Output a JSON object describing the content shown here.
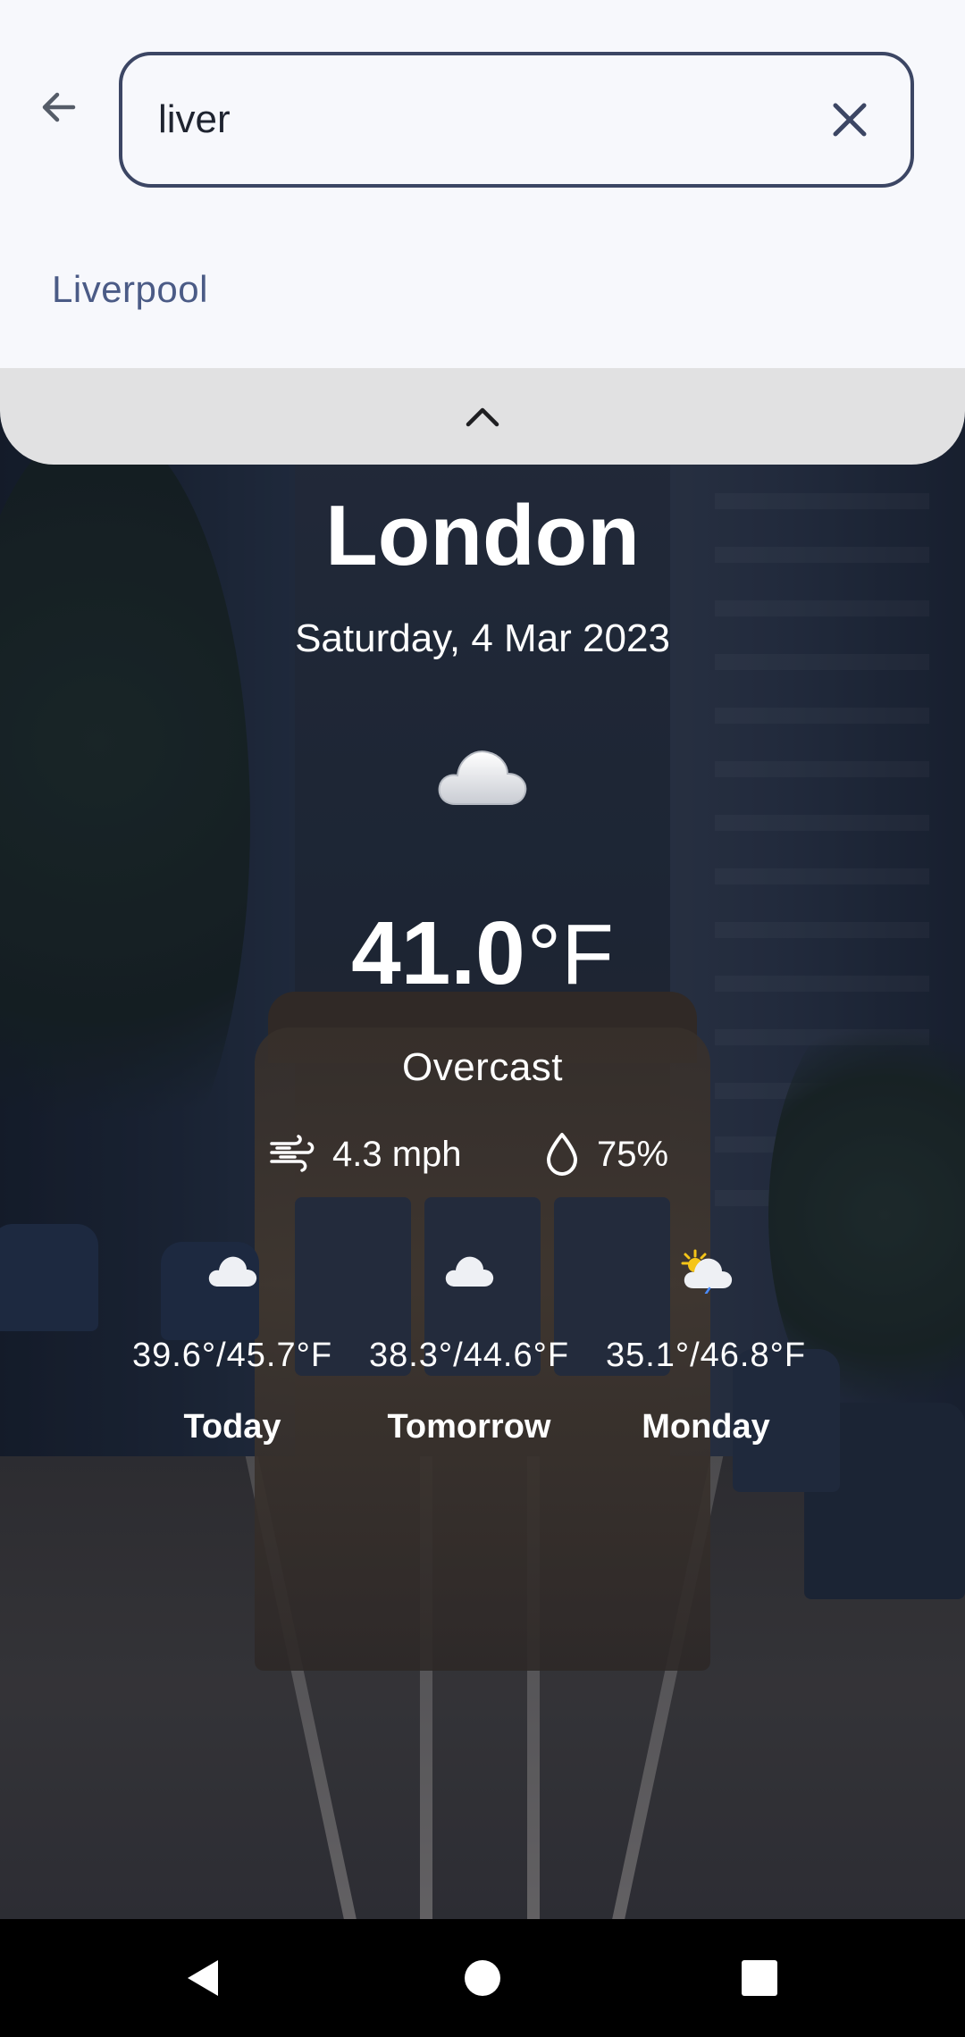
{
  "search": {
    "query": "liver",
    "suggestions": [
      "Liverpool"
    ]
  },
  "icons": {
    "back": "arrow-left-icon",
    "clear": "close-icon",
    "sheet_toggle": "chevron-up-icon",
    "condition": "cloud-icon",
    "wind": "wind-icon",
    "humidity": "droplet-icon"
  },
  "weather": {
    "city": "London",
    "date": "Saturday, 4 Mar 2023",
    "temperature": "41.0",
    "unit": "°F",
    "condition": "Overcast",
    "wind": "4.3 mph",
    "humidity": "75%"
  },
  "forecast": [
    {
      "day": "Today",
      "range": "39.6°/45.7°F",
      "icon": "cloud-icon"
    },
    {
      "day": "Tomorrow",
      "range": "38.3°/44.6°F",
      "icon": "cloud-icon"
    },
    {
      "day": "Monday",
      "range": "35.1°/46.8°F",
      "icon": "partly-sunny-icon"
    }
  ],
  "colors": {
    "search_border": "#3c4664",
    "suggestion_text": "#4b5b86",
    "sheet_handle": "#e1e1e2",
    "nav_bar": "#000000"
  }
}
